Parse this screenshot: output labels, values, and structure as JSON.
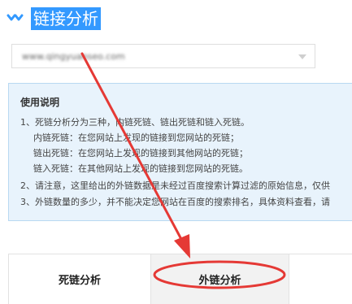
{
  "header": {
    "title": "链接分析",
    "icon": "double-chevron-down-icon",
    "accent_color": "#3399ff"
  },
  "site_select": {
    "value": "www.qingyuanseo.com"
  },
  "info": {
    "title": "使用说明",
    "lines": [
      "1、死链分析分为三种，内链死链、链出死链和链入死链。",
      "内链死链：在您网站上发现的链接到您网站的死链；",
      "链出死链：在您网站上发现的链接到其他网站的死链；",
      "链入死链：在其他网站上发现的链接到您网站的死链。",
      "2、请注意，这里给出的外链数据是未经过百度搜索计算过滤的原始信息，仅供",
      "3、外链数量的多少，并不能决定您网站在百度的搜索排名，具体资料查看，请"
    ],
    "background": "#e8f3fc"
  },
  "tabs": [
    {
      "label": "死链分析"
    },
    {
      "label": "外链分析"
    }
  ],
  "annotation": {
    "color": "#e53935"
  }
}
